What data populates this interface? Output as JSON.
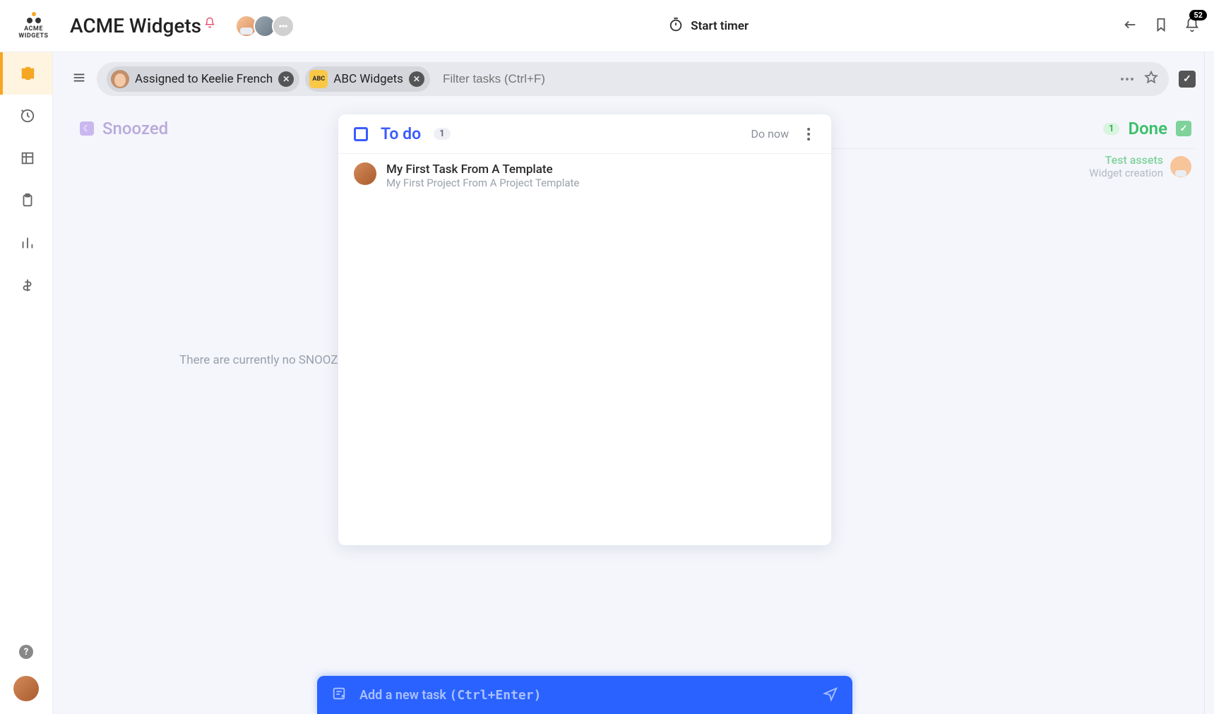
{
  "logo": {
    "line1": "ACME",
    "line2": "WIDGETS"
  },
  "workspace": {
    "title": "ACME Widgets"
  },
  "timer": {
    "label": "Start timer"
  },
  "notifications": {
    "count": "52"
  },
  "filters": {
    "chip_assigned": "Assigned to Keelie French",
    "chip_client_abbr": "ABC",
    "chip_client": "ABC Widgets",
    "placeholder": "Filter tasks (Ctrl+F)"
  },
  "columns": {
    "snoozed": {
      "title": "Snoozed",
      "empty": "There are currently no SNOOZ"
    },
    "done": {
      "count": "1",
      "title": "Done",
      "task_title": "Test assets",
      "task_sub": "Widget creation"
    }
  },
  "todo": {
    "title": "To do",
    "count": "1",
    "donow": "Do now",
    "task_title": "My First Task From A Template",
    "task_sub": "My First Project From A Project Template"
  },
  "addbar": {
    "label": "Add a new task ",
    "hint": "(Ctrl+Enter)"
  }
}
